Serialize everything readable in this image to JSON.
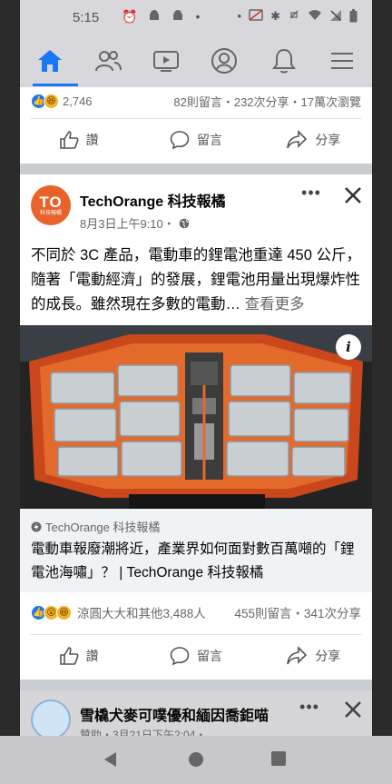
{
  "status_bar": {
    "time": "5:15",
    "left_icons": [
      "alarm-icon",
      "android-icon",
      "android-icon",
      "dot-icon"
    ],
    "right_icons": [
      "dot-icon",
      "nfc-off-icon",
      "bluetooth-icon",
      "mute-icon",
      "wifi-icon",
      "no-signal-icon",
      "battery-icon"
    ]
  },
  "nav_tabs": [
    {
      "name": "home",
      "icon": "home-icon",
      "active": true
    },
    {
      "name": "friends",
      "icon": "friends-icon",
      "active": false
    },
    {
      "name": "watch",
      "icon": "video-icon",
      "active": false
    },
    {
      "name": "profile",
      "icon": "profile-icon",
      "active": false
    },
    {
      "name": "notifications",
      "icon": "bell-icon",
      "active": false
    },
    {
      "name": "menu",
      "icon": "menu-icon",
      "active": false
    }
  ],
  "prev_post": {
    "reaction_count": "2,746",
    "stats": "82則留言・232次分享・17萬次瀏覽",
    "actions": {
      "like": "讚",
      "comment": "留言",
      "share": "分享"
    }
  },
  "post": {
    "author": "TechOrange 科技報橘",
    "avatar_text": "TO",
    "avatar_subtext": "科技報橘",
    "time": "8月3日上午9:10・",
    "privacy_icon": "globe-icon",
    "text": "不同於 3C 產品，電動車的鋰電池重達 450 公斤，隨著「電動經濟」的發展，鋰電池用量出現爆炸性的成長。雖然現在多數的電動…",
    "see_more": "查看更多",
    "image_badge": "i",
    "link": {
      "source": "TechOrange 科技報橘",
      "title": "電動車報廢潮將近，產業界如何面對數百萬噸的「鋰電池海嘯」？ | TechOrange 科技報橘"
    },
    "reactions_names": "涼圓大大和其他3,488人",
    "stats": "455則留言・341次分享",
    "actions": {
      "like": "讚",
      "comment": "留言",
      "share": "分享"
    }
  },
  "next_post": {
    "author": "雪橇犬麥可噗優和緬因喬鉅喵",
    "sub": "贊助・3月21日下午2:04・"
  },
  "colors": {
    "accent": "#1877f2",
    "brand_orange": "#e8622a",
    "battery_orange": "#d9541e"
  }
}
